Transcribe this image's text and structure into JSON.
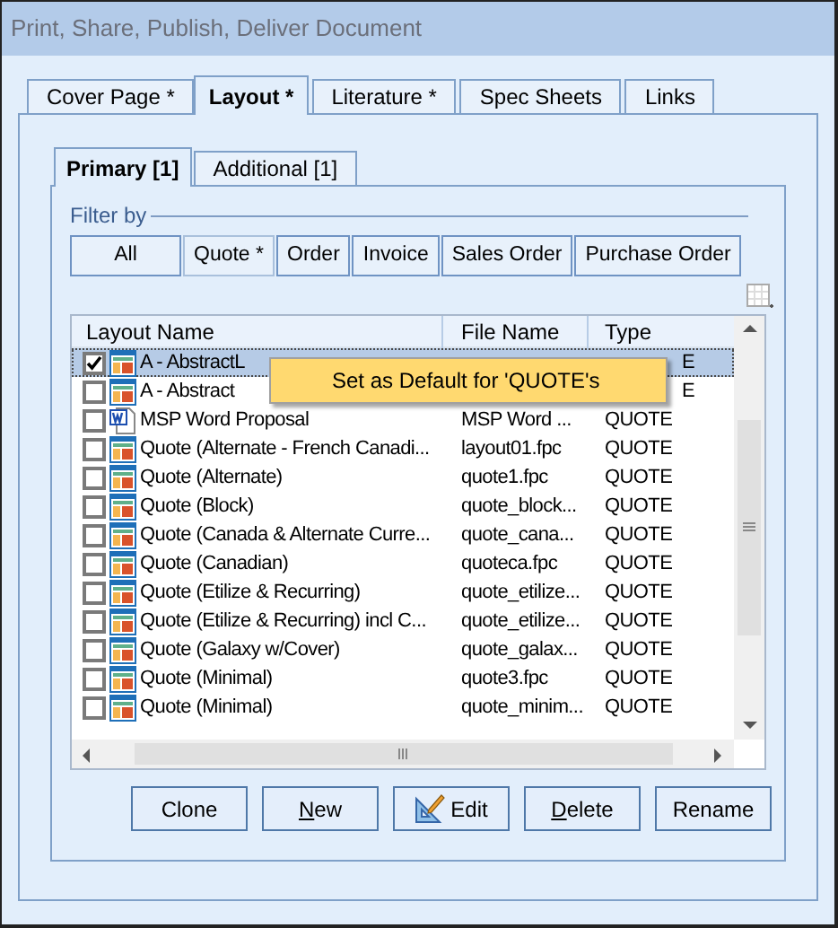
{
  "window": {
    "title": "Print, Share, Publish, Deliver Document"
  },
  "tabs": [
    {
      "label": "Cover Page *",
      "selected": false
    },
    {
      "label": "Layout *",
      "selected": true
    },
    {
      "label": "Literature *",
      "selected": false
    },
    {
      "label": "Spec Sheets",
      "selected": false
    },
    {
      "label": "Links",
      "selected": false
    }
  ],
  "subtabs": [
    {
      "label": "Primary [1]",
      "selected": true
    },
    {
      "label": "Additional [1]",
      "selected": false
    }
  ],
  "filter": {
    "legend": "Filter by",
    "buttons": [
      {
        "label": "All",
        "selected": false
      },
      {
        "label": "Quote *",
        "selected": true
      },
      {
        "label": "Order",
        "selected": false
      },
      {
        "label": "Invoice",
        "selected": false
      },
      {
        "label": "Sales Order",
        "selected": false
      },
      {
        "label": "Purchase Order",
        "selected": false
      }
    ]
  },
  "table": {
    "columns": [
      "Layout Name",
      "File Name",
      "Type"
    ],
    "rows": [
      {
        "kind": "layout",
        "name": "A - AbstractL",
        "type_tail": "E",
        "checked": true,
        "selected": true
      },
      {
        "kind": "layout",
        "name": "A - Abstract",
        "type_tail": "E",
        "checked": false,
        "selected": false
      },
      {
        "kind": "word",
        "name": "MSP Word Proposal",
        "file": "MSP Word ...",
        "type": "QUOTE",
        "checked": false,
        "selected": false
      },
      {
        "kind": "layout",
        "name": "Quote (Alternate - French Canadi...",
        "file": "layout01.fpc",
        "type": "QUOTE",
        "checked": false,
        "selected": false
      },
      {
        "kind": "layout",
        "name": "Quote (Alternate)",
        "file": "quote1.fpc",
        "type": "QUOTE",
        "checked": false,
        "selected": false
      },
      {
        "kind": "layout",
        "name": "Quote (Block)",
        "file": "quote_block...",
        "type": "QUOTE",
        "checked": false,
        "selected": false
      },
      {
        "kind": "layout",
        "name": "Quote (Canada & Alternate Curre...",
        "file": "quote_cana...",
        "type": "QUOTE",
        "checked": false,
        "selected": false
      },
      {
        "kind": "layout",
        "name": "Quote (Canadian)",
        "file": "quoteca.fpc",
        "type": "QUOTE",
        "checked": false,
        "selected": false
      },
      {
        "kind": "layout",
        "name": "Quote (Etilize & Recurring)",
        "file": "quote_etilize...",
        "type": "QUOTE",
        "checked": false,
        "selected": false
      },
      {
        "kind": "layout",
        "name": "Quote (Etilize & Recurring) incl C...",
        "file": "quote_etilize...",
        "type": "QUOTE",
        "checked": false,
        "selected": false
      },
      {
        "kind": "layout",
        "name": "Quote (Galaxy w/Cover)",
        "file": "quote_galax...",
        "type": "QUOTE",
        "checked": false,
        "selected": false
      },
      {
        "kind": "layout",
        "name": "Quote (Minimal)",
        "file": "quote3.fpc",
        "type": "QUOTE",
        "checked": false,
        "selected": false
      },
      {
        "kind": "layout",
        "name": "Quote (Minimal)",
        "file": "quote_minim...",
        "type": "QUOTE",
        "checked": false,
        "selected": false
      }
    ]
  },
  "context_menu": {
    "items": [
      "Set as Default for 'QUOTE's"
    ]
  },
  "buttons": [
    {
      "kind": "plain",
      "label": "Clone"
    },
    {
      "kind": "mnemonic",
      "accel": "N",
      "rest": "ew"
    },
    {
      "kind": "icon",
      "label": "Edit"
    },
    {
      "kind": "mnemonic",
      "accel": "D",
      "rest": "elete"
    },
    {
      "kind": "plain",
      "label": "Rename"
    }
  ]
}
